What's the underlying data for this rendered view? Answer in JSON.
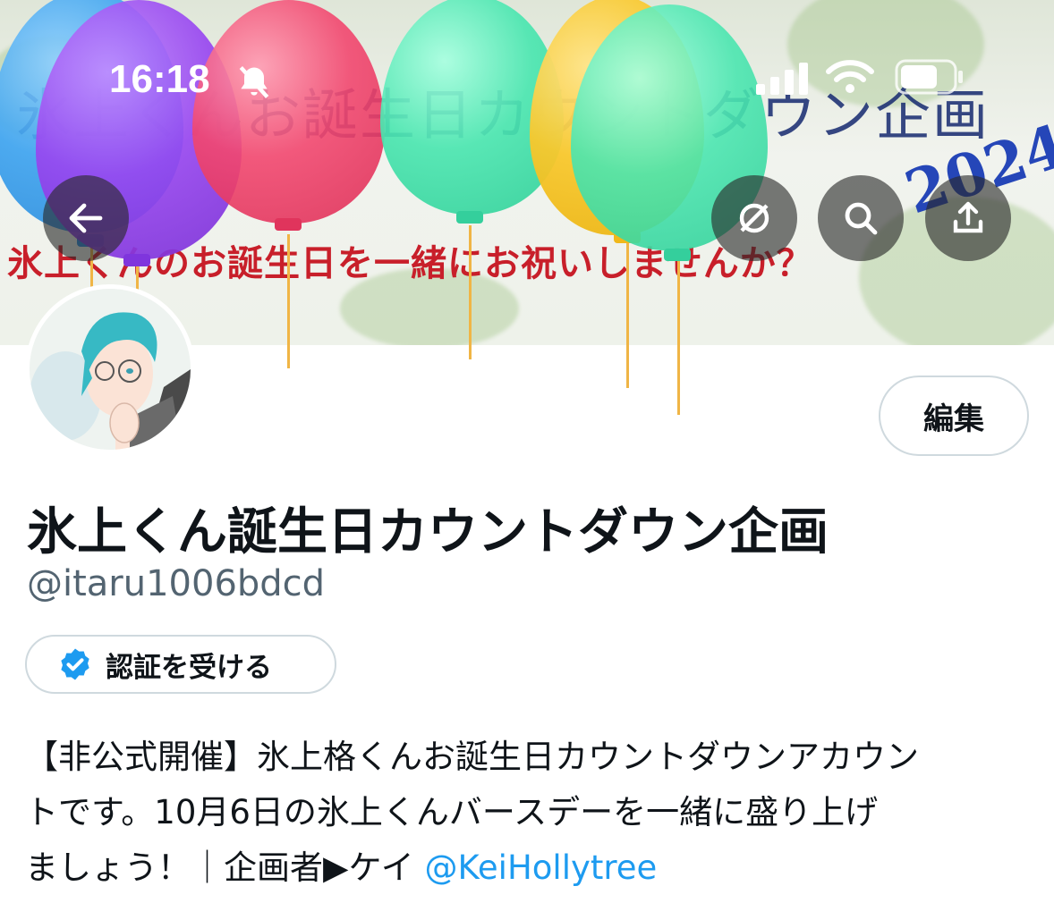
{
  "status_bar": {
    "time": "16:18"
  },
  "banner": {
    "title": "氷上くんお誕生日カウントダウン企画",
    "year": "2024",
    "subtitle": "氷上くんのお誕生日を一緒にお祝いしませんか？"
  },
  "header": {
    "edit_label": "編集"
  },
  "profile": {
    "display_name": "氷上くん誕生日カウントダウン企画",
    "handle": "@itaru1006bdcd",
    "verify_label": "認証を受ける",
    "bio_line1": "【非公式開催】氷上格くんお誕生日カウントダウンアカウン",
    "bio_line2": "トです。10月6日の氷上くんバースデーを一緒に盛り上げ",
    "bio_line3": "ましょう！｜企画者▶ケイ ",
    "bio_mention": "@KeiHollytree"
  },
  "colors": {
    "accent": "#1d9bf0",
    "text": "#0f1419",
    "secondary_text": "#536471",
    "border": "#cfd9de"
  },
  "icons": [
    "back-arrow-icon",
    "bell-slash-icon",
    "signal-icon",
    "wifi-icon",
    "battery-icon",
    "translate-icon",
    "search-icon",
    "share-icon",
    "verified-badge-icon"
  ]
}
